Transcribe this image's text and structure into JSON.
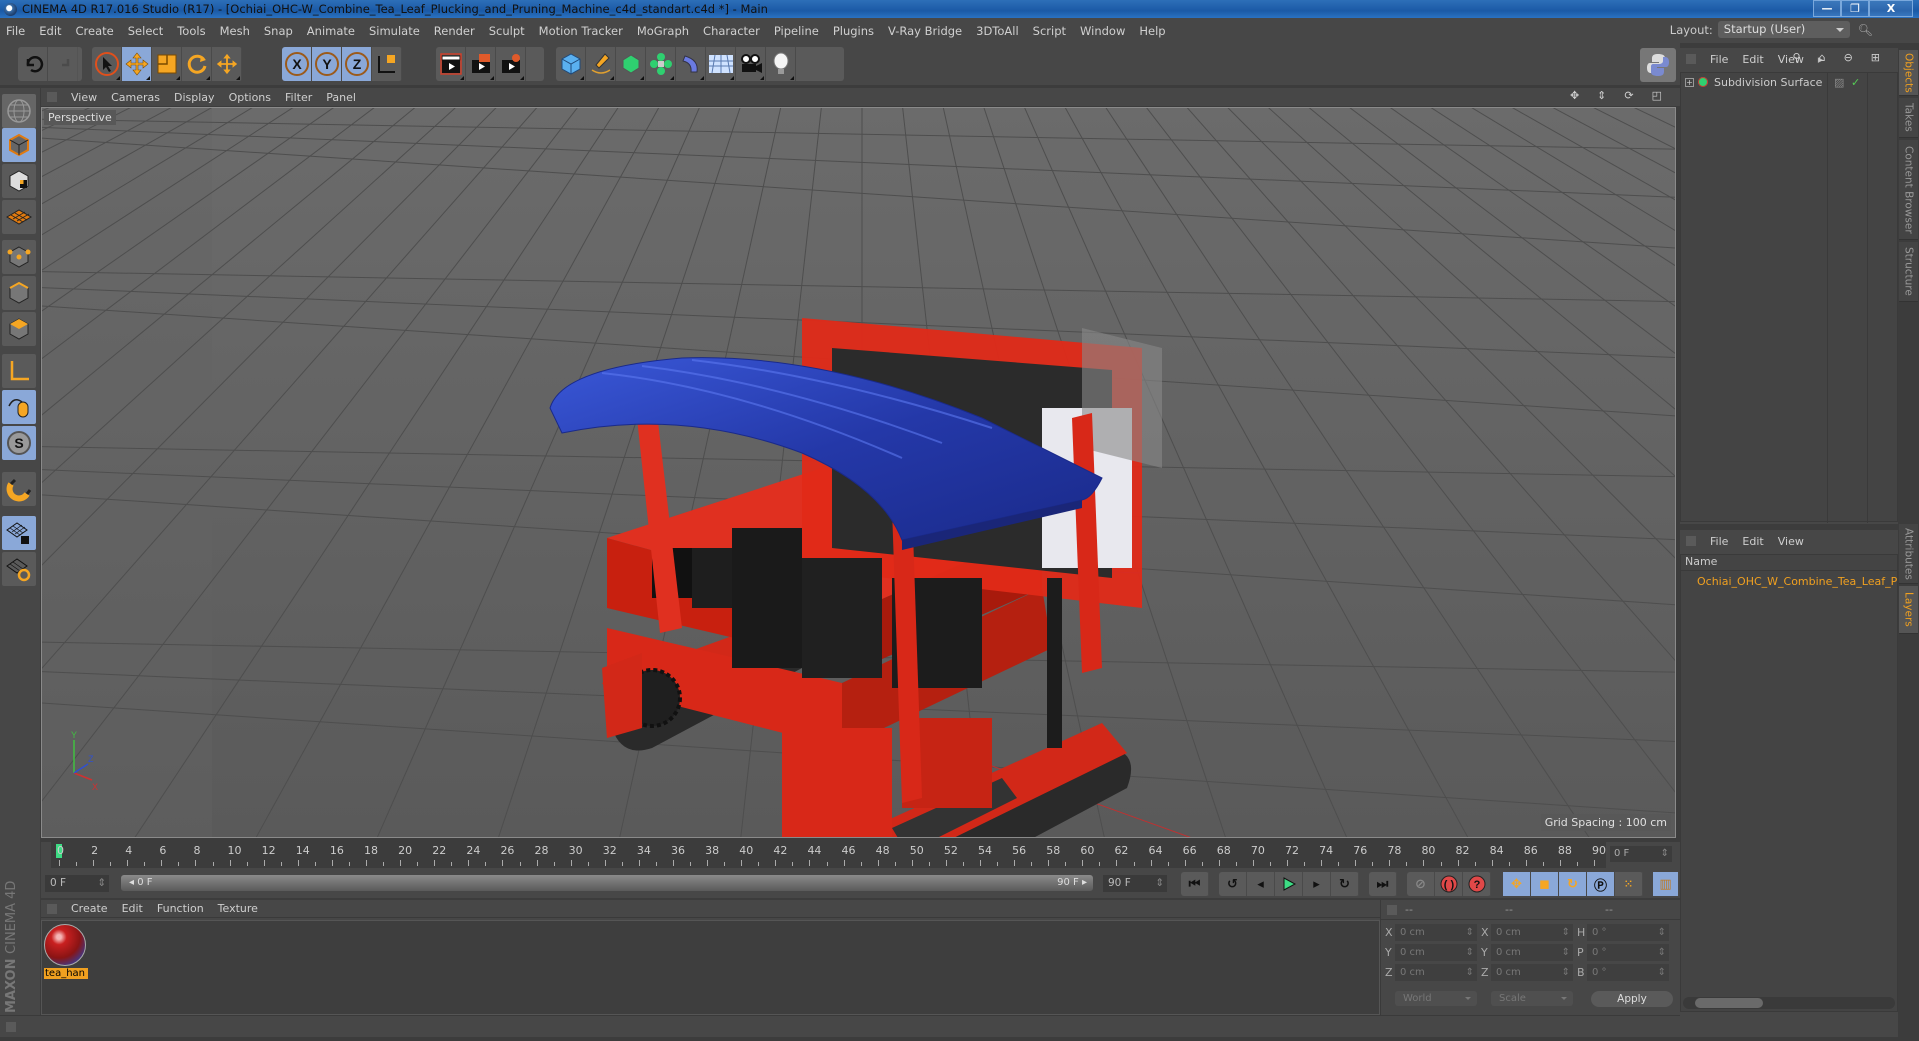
{
  "window": {
    "title": "CINEMA 4D R17.016 Studio (R17) - [Ochiai_OHC-W_Combine_Tea_Leaf_Plucking_and_Pruning_Machine_c4d_standart.c4d *] - Main",
    "minimize_label": "—",
    "restore_label": "❐",
    "close_label": "X"
  },
  "menubar": {
    "items": [
      "File",
      "Edit",
      "Create",
      "Select",
      "Tools",
      "Mesh",
      "Snap",
      "Animate",
      "Simulate",
      "Render",
      "Sculpt",
      "Motion Tracker",
      "MoGraph",
      "Character",
      "Pipeline",
      "Plugins",
      "V-Ray Bridge",
      "3DToAll",
      "Script",
      "Window",
      "Help"
    ],
    "layout_label": "Layout:",
    "layout_value": "Startup (User)"
  },
  "toolbar": {
    "undo": "undo-icon",
    "redo": "redo-icon",
    "tools": [
      "live-selection",
      "move",
      "scale",
      "rotate",
      "last-tool"
    ],
    "axes": [
      "X",
      "Y",
      "Z"
    ],
    "coord_system": "world-coordinates-icon",
    "render": [
      "render-view",
      "render-picture-viewer",
      "render-settings"
    ],
    "objects": [
      "cube",
      "pen-spline",
      "subdivision-nurbs",
      "mograph-cloner",
      "deformer-bend",
      "floor-environment",
      "camera",
      "light"
    ]
  },
  "viewport": {
    "menu": [
      "View",
      "Cameras",
      "Display",
      "Options",
      "Filter",
      "Panel"
    ],
    "label": "Perspective",
    "grid_spacing": "Grid Spacing : 100 cm",
    "axis_labels": {
      "x": "X",
      "y": "Y",
      "z": "Z"
    }
  },
  "colors": {
    "accent_orange": "#f0a020",
    "active_blue": "#8aa8d8",
    "playhead_green": "#3ddc84",
    "machine_red": "#e8281a",
    "canopy_blue": "#2a40b0",
    "layer_cyan": "#4fd8e8"
  },
  "timeline": {
    "ticks": [
      "0",
      "2",
      "4",
      "6",
      "8",
      "10",
      "12",
      "14",
      "16",
      "18",
      "20",
      "22",
      "24",
      "26",
      "28",
      "30",
      "32",
      "34",
      "36",
      "38",
      "40",
      "42",
      "44",
      "46",
      "48",
      "50",
      "52",
      "54",
      "56",
      "58",
      "60",
      "62",
      "64",
      "66",
      "68",
      "70",
      "72",
      "74",
      "76",
      "78",
      "80",
      "82",
      "84",
      "86",
      "88",
      "90"
    ],
    "current_frame": "0 F",
    "start_field": "0 F",
    "range_start": "0 F",
    "range_end": "90 F",
    "end_field": "90 F",
    "current_position": 0
  },
  "playback": {
    "buttons": [
      "go-to-start",
      "previous-key",
      "previous-frame",
      "play",
      "next-frame",
      "next-key",
      "go-to-end"
    ],
    "record": [
      "autokey-disabled",
      "record-active-objects",
      "autokeying"
    ],
    "key_tracks": [
      "position",
      "scale",
      "rotation",
      "parameter",
      "point-level-animation"
    ],
    "scheme": "timeline-scheme"
  },
  "material_manager": {
    "menu": [
      "Create",
      "Edit",
      "Function",
      "Texture"
    ],
    "materials": [
      {
        "name": "tea_han"
      }
    ]
  },
  "branding": {
    "maxon": "MAXON",
    "cinema": "CINEMA 4D"
  },
  "coordinates": {
    "headers": [
      "--",
      "--",
      "--"
    ],
    "position": [
      {
        "axis": "X",
        "value": "0 cm"
      },
      {
        "axis": "Y",
        "value": "0 cm"
      },
      {
        "axis": "Z",
        "value": "0 cm"
      }
    ],
    "size": [
      {
        "axis": "X",
        "value": "0 cm"
      },
      {
        "axis": "Y",
        "value": "0 cm"
      },
      {
        "axis": "Z",
        "value": "0 cm"
      }
    ],
    "rotation": [
      {
        "axis": "H",
        "value": "0 °"
      },
      {
        "axis": "P",
        "value": "0 °"
      },
      {
        "axis": "B",
        "value": "0 °"
      }
    ],
    "mode": "World",
    "size_mode": "Scale",
    "apply_label": "Apply"
  },
  "object_manager": {
    "menu": [
      "File",
      "Edit",
      "View"
    ],
    "objects": [
      {
        "name": "Subdivision Surface",
        "expanded": false,
        "enabled": true
      }
    ]
  },
  "layer_manager": {
    "menu": [
      "File",
      "Edit",
      "View"
    ],
    "column": "Name",
    "layers": [
      {
        "name": "Ochiai_OHC_W_Combine_Tea_Leaf_Plucking_and_Pruning_Machine"
      }
    ]
  },
  "side_tabs": {
    "top": [
      {
        "label": "Objects",
        "active": true
      },
      {
        "label": "Takes",
        "active": false
      },
      {
        "label": "Content Browser",
        "active": false
      },
      {
        "label": "Structure",
        "active": false
      }
    ],
    "bottom": [
      {
        "label": "Attributes",
        "active": false
      },
      {
        "label": "Layers",
        "active": true
      }
    ]
  }
}
